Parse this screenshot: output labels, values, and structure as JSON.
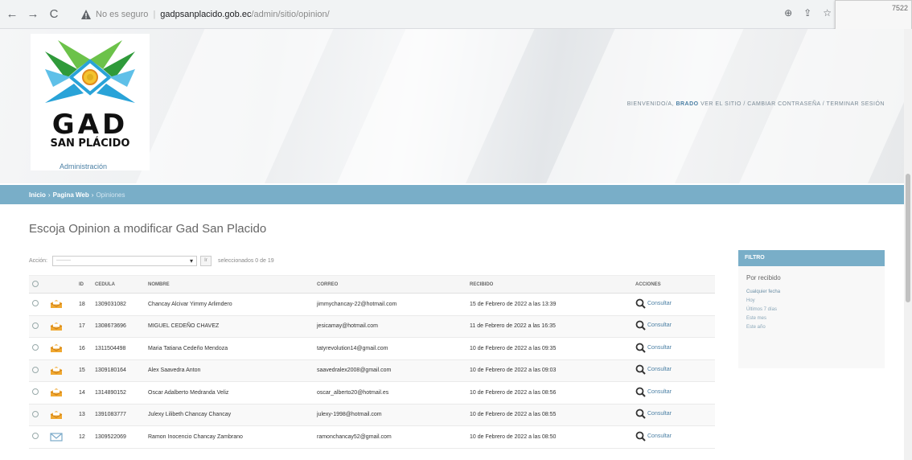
{
  "browser": {
    "nav_back": "←",
    "nav_forward": "→",
    "nav_reload": "C",
    "security_label": "No es seguro",
    "host": "gadpsanplacido.gob.ec",
    "path": "/admin/sitio/opinion/",
    "action_zoom": "⊕",
    "action_share": "⇪",
    "action_star": "☆",
    "corner_text": "7522"
  },
  "header": {
    "logo_main": "GAD",
    "logo_sub": "SAN PLÁCIDO",
    "logo_caption": "Administración",
    "user_tools": {
      "welcome": "BIENVENIDO/A,",
      "user": "BRADO",
      "rest": "VER EL SITIO / CAMBIAR CONTRASEÑA / TERMINAR SESIÓN"
    }
  },
  "breadcrumbs": {
    "home": "Inicio",
    "section": "Pagina Web",
    "current": "Opiniones",
    "separator": "›"
  },
  "main": {
    "title": "Escoja Opinion a modificar Gad San Placido",
    "action_label": "Acción:",
    "action_placeholder": "---------",
    "go_label": "Ir",
    "counter": "seleccionados 0 de 19"
  },
  "table": {
    "headers": [
      "",
      "",
      "ID",
      "CEDULA",
      "NOMBRE",
      "CORREO",
      "RECIBIDO",
      "ACCIONES"
    ],
    "action_label": "Consultar",
    "rows": [
      {
        "id": "18",
        "cedula": "1309031082",
        "nombre": "Chancay Alcivar Yimmy Arlimdero",
        "correo": "jimmychancay-22@hotmail.com",
        "recibido": "15 de Febrero de 2022 a las 13:39",
        "icon": "envelope-open-icon"
      },
      {
        "id": "17",
        "cedula": "1308673696",
        "nombre": "MIGUEL CEDEÑO CHAVEZ",
        "correo": "jesicamay@hotmail.com",
        "recibido": "11 de Febrero de 2022 a las 16:35",
        "icon": "envelope-open-icon"
      },
      {
        "id": "16",
        "cedula": "1311504498",
        "nombre": "Maria Tatiana Cedeño Mendoza",
        "correo": "tatyrevolution14@gmail.com",
        "recibido": "10 de Febrero de 2022 a las 09:35",
        "icon": "envelope-open-icon"
      },
      {
        "id": "15",
        "cedula": "1309180164",
        "nombre": "Alex Saavedra Anton",
        "correo": "saavedralex2008@gmail.com",
        "recibido": "10 de Febrero de 2022 a las 09:03",
        "icon": "envelope-open-icon"
      },
      {
        "id": "14",
        "cedula": "1314890152",
        "nombre": "Oscar Adalberto Medranda Veliz",
        "correo": "oscar_alberto20@hotmail.es",
        "recibido": "10 de Febrero de 2022 a las 08:56",
        "icon": "envelope-open-icon"
      },
      {
        "id": "13",
        "cedula": "1391083777",
        "nombre": "Julexy Lilibeth Chancay Chancay",
        "correo": "julexy-1998@hotmail.com",
        "recibido": "10 de Febrero de 2022 a las 08:55",
        "icon": "envelope-open-icon"
      },
      {
        "id": "12",
        "cedula": "1309522069",
        "nombre": "Ramon Inocencio Chancay Zambrano",
        "correo": "ramonchancay52@gmail.com",
        "recibido": "10 de Febrero de 2022 a las 08:50",
        "icon": "envelope-closed-icon"
      }
    ]
  },
  "filter": {
    "title": "FILTRO",
    "subtitle": "Por recibido",
    "options": [
      "Cualquier fecha",
      "Hoy",
      "Últimos 7 días",
      "Este mes",
      "Este año"
    ]
  },
  "colors": {
    "accent": "#79aec8",
    "link": "#4a7fa4",
    "envelope": "#f0a830"
  }
}
